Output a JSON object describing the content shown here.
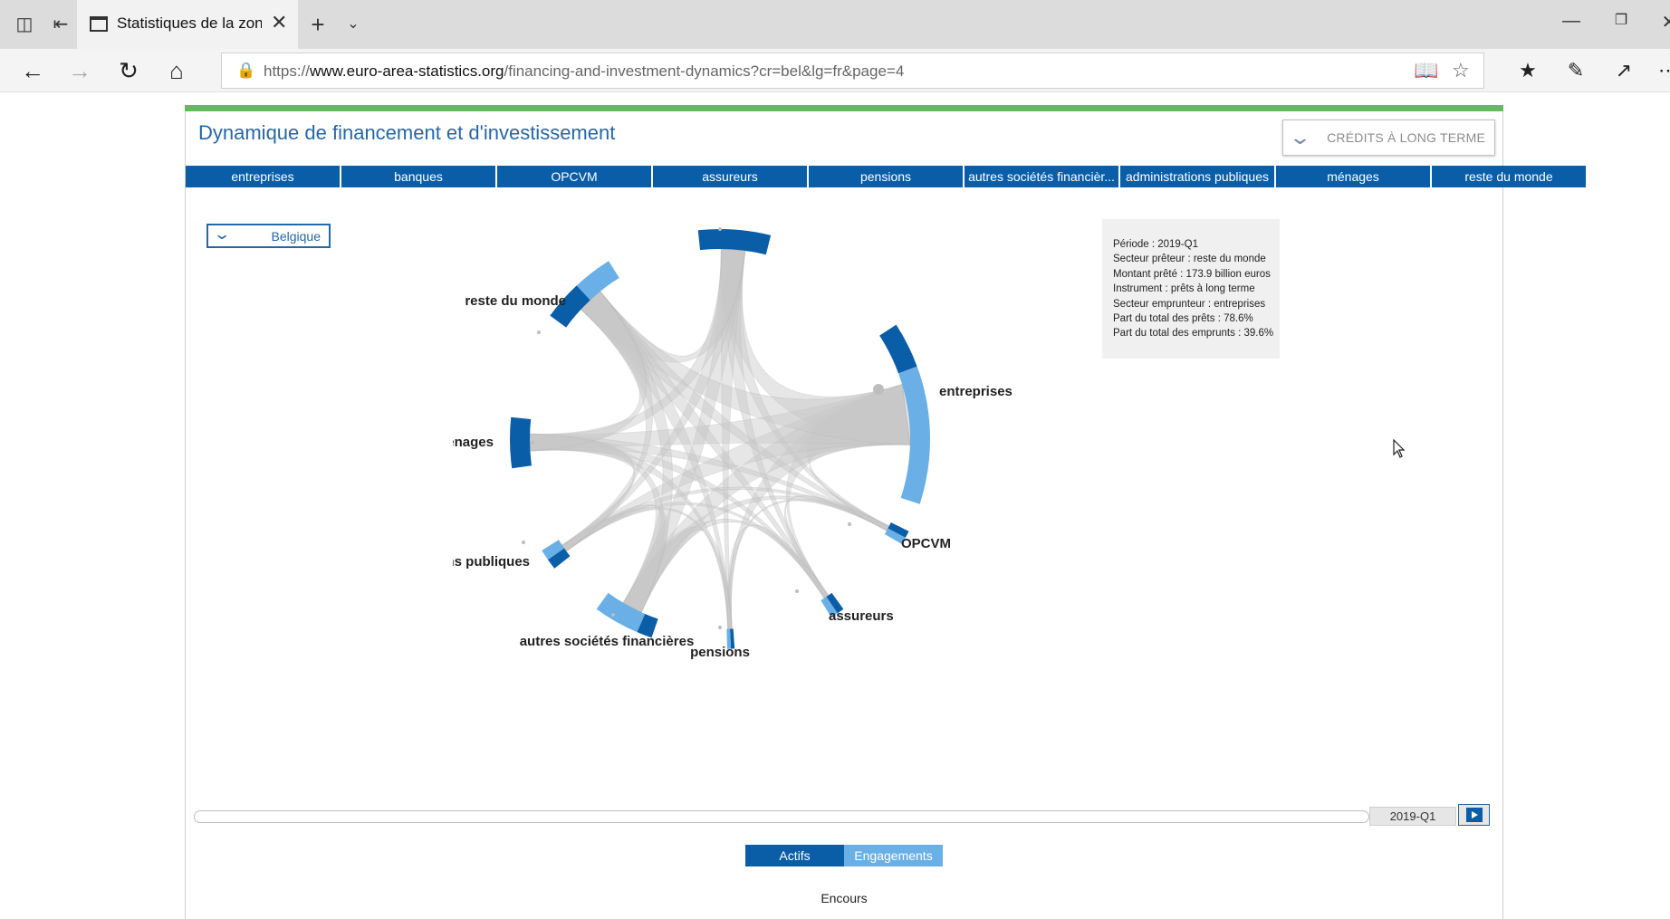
{
  "browser": {
    "tab_title": "Statistiques de la zone euro",
    "url_scheme": "https://",
    "url_host": "www.euro-area-statistics.org",
    "url_path": "/financing-and-investment-dynamics?cr=bel&lg=fr&page=4"
  },
  "page": {
    "title": "Dynamique de financement et d'investissement",
    "instrument_dropdown": "CRÉDITS À LONG TERME",
    "country_dropdown": "Belgique",
    "sector_tabs": [
      "entreprises",
      "banques",
      "OPCVM",
      "assureurs",
      "pensions",
      "autres sociétés financièr...",
      "administrations publiques",
      "ménages",
      "reste du monde"
    ]
  },
  "chart_data": {
    "type": "chord",
    "nodes": [
      {
        "name": "banques",
        "color_outer": "#0a5ea8",
        "color_inner": "#6aafe6"
      },
      {
        "name": "entreprises",
        "color_outer": "#0a5ea8",
        "color_inner": "#6aafe6"
      },
      {
        "name": "OPCVM",
        "color_outer": "#0a5ea8",
        "color_inner": "#6aafe6"
      },
      {
        "name": "assureurs",
        "color_outer": "#0a5ea8",
        "color_inner": "#6aafe6"
      },
      {
        "name": "pensions",
        "color_outer": "#0a5ea8",
        "color_inner": "#6aafe6"
      },
      {
        "name": "autres sociétés financières",
        "color_outer": "#0a5ea8",
        "color_inner": "#6aafe6"
      },
      {
        "name": "administrations publiques",
        "color_outer": "#0a5ea8",
        "color_inner": "#6aafe6"
      },
      {
        "name": "ménages",
        "color_outer": "#0a5ea8",
        "color_inner": "#6aafe6"
      },
      {
        "name": "reste du monde",
        "color_outer": "#0a5ea8",
        "color_inner": "#6aafe6"
      }
    ],
    "tooltip": {
      "lines": [
        "Période : 2019-Q1",
        "Secteur prêteur : reste du monde",
        "Montant prêté : 173.9 billion euros",
        "Instrument : prêts à long terme",
        "Secteur emprunteur : entreprises",
        "Part du total des prêts : 78.6%",
        "Part du total des emprunts : 39.6%"
      ]
    }
  },
  "timeline": {
    "period": "2019-Q1"
  },
  "toggle": {
    "actifs": "Actifs",
    "engagements": "Engagements"
  },
  "footer_label": "Encours",
  "colors": {
    "accent_blue": "#0a5ea8",
    "light_blue": "#6aafe6",
    "green_bar": "#67b765",
    "title_blue": "#2667a8"
  }
}
